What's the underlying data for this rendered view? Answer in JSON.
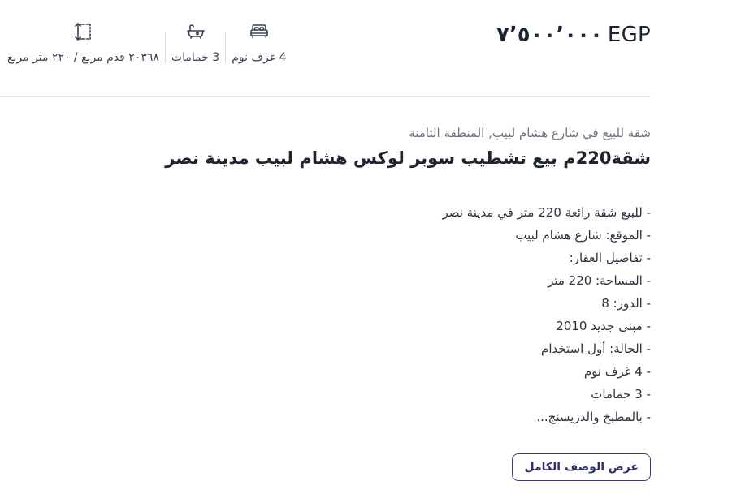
{
  "listing": {
    "price_value": "٧٬٥٠٠٬٠٠٠",
    "price_currency": "EGP",
    "stats": {
      "area_label": "٢٠٣٦٨ قدم مربع / ٢٢٠ متر مربع",
      "area_icon": "area-resize-icon",
      "bathrooms_label": "3 حمامات",
      "bathrooms_icon": "bathtub-icon",
      "bedrooms_label": "4 غرف نوم",
      "bedrooms_icon": "bed-icon"
    },
    "subtitle": "شقة للبيع في شارع هشام لبيب, المنطقة الثامنة",
    "title": "شقة220م بيع تشطيب سوبر لوكس هشام لبيب مدينة نصر",
    "description": [
      "- للبيع شقة رائعة 220 متر في مدينة نصر",
      "- الموقع: شارع هشام لبيب",
      "- تفاصيل العقار:",
      "- المساحة: 220 متر",
      "- الدور: 8",
      "- مبنى جديد 2010",
      "- الحالة: أول استخدام",
      "- 4 غرف نوم",
      "- 3 حمامات",
      "- بالمطبخ والدريسنج..."
    ],
    "show_full_description_label": "عرض الوصف الكامل"
  },
  "colors": {
    "accent": "#2c2e68",
    "text_dark": "#1f2430",
    "text_muted": "#6f7480",
    "divider": "#e6e8ee"
  }
}
